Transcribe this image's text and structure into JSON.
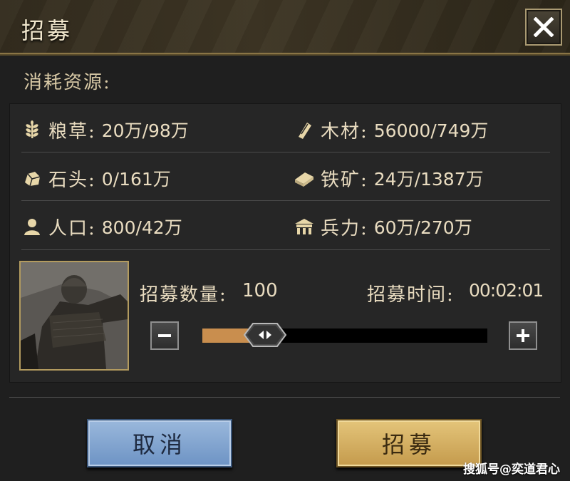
{
  "dialog": {
    "title": "招募",
    "close_icon": "close-icon"
  },
  "consume": {
    "label": "消耗资源:"
  },
  "resources": [
    {
      "icon": "grain-icon",
      "label": "粮草:",
      "value": "20万/98万"
    },
    {
      "icon": "wood-icon",
      "label": "木材:",
      "value": "56000/749万"
    },
    {
      "icon": "stone-icon",
      "label": "石头:",
      "value": "0/161万"
    },
    {
      "icon": "iron-icon",
      "label": "铁矿:",
      "value": "24万/1387万"
    },
    {
      "icon": "population-icon",
      "label": "人口:",
      "value": "800/42万"
    },
    {
      "icon": "troops-icon",
      "label": "兵力:",
      "value": "60万/270万"
    }
  ],
  "recruit": {
    "count_label": "招募数量:",
    "count_value": "100",
    "time_label": "招募时间:",
    "time_value": "00:02:01",
    "slider_fraction": 0.22
  },
  "buttons": {
    "cancel": "取消",
    "confirm": "招募"
  },
  "watermark": "搜狐号@奕道君心",
  "colors": {
    "accent_gold": "#b39b5f",
    "slider_fill": "#c98e4e",
    "cancel_blue": "#7b9fd0",
    "confirm_gold": "#d6b265"
  }
}
